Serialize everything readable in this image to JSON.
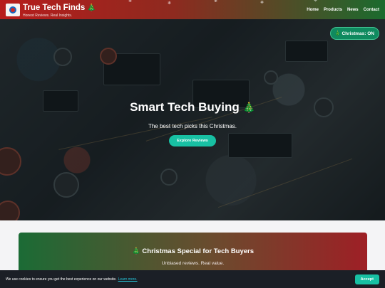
{
  "header": {
    "title": "True Tech Finds",
    "tree": "🎄",
    "tagline": "Honest Reviews. Real Insights.",
    "nav": [
      "Home",
      "Products",
      "News",
      "Contact"
    ],
    "snow": "❄"
  },
  "toggle": {
    "label": "🎄 Christmas: ON"
  },
  "hero": {
    "title": "Smart Tech Buying",
    "tree": "🎄",
    "subtitle": "The best tech picks this Christmas.",
    "button": "Explore Reviews"
  },
  "special": {
    "title": "🎄 Christmas Special for Tech Buyers",
    "subtitle": "Unbiased reviews. Real value."
  },
  "cookie": {
    "text": "We use cookies to ensure you get the best experience on our website.",
    "link": "Learn more.",
    "accept": "Accept"
  },
  "colors": {
    "accent": "#18c0a3",
    "red": "#b71c1c",
    "green": "#1b6b2e",
    "cookie_bg": "#1b1f26"
  }
}
